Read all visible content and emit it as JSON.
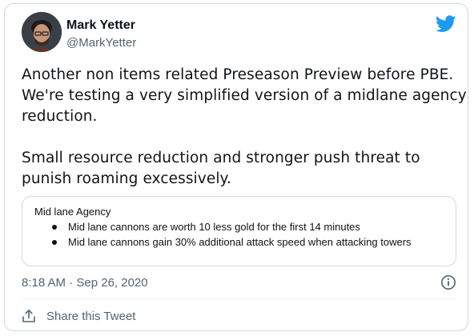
{
  "author": {
    "name": "Mark Yetter",
    "handle": "@MarkYetter"
  },
  "tweet": {
    "lines": [
      "Another non items related Preseason Preview before PBE.",
      "We're testing a very simplified version of a midlane agency",
      "reduction.",
      "",
      "Small resource reduction and stronger push threat to",
      "punish roaming excessively."
    ]
  },
  "media": {
    "title": "Mid lane Agency",
    "bullets": [
      "Mid lane cannons are worth 10 less gold for the first 14 minutes",
      "Mid lane cannons gain 30% additional attack speed when attacking towers"
    ]
  },
  "meta": {
    "timestamp": "8:18 AM · Sep 26, 2020"
  },
  "actions": {
    "share_label": "Share this Tweet"
  },
  "icons": {
    "brand": "twitter-bird-icon",
    "info": "info-icon",
    "share": "share-icon"
  },
  "colors": {
    "brand": "#1d9bf0",
    "secondary_text": "#536471",
    "border": "#cfd9de"
  }
}
